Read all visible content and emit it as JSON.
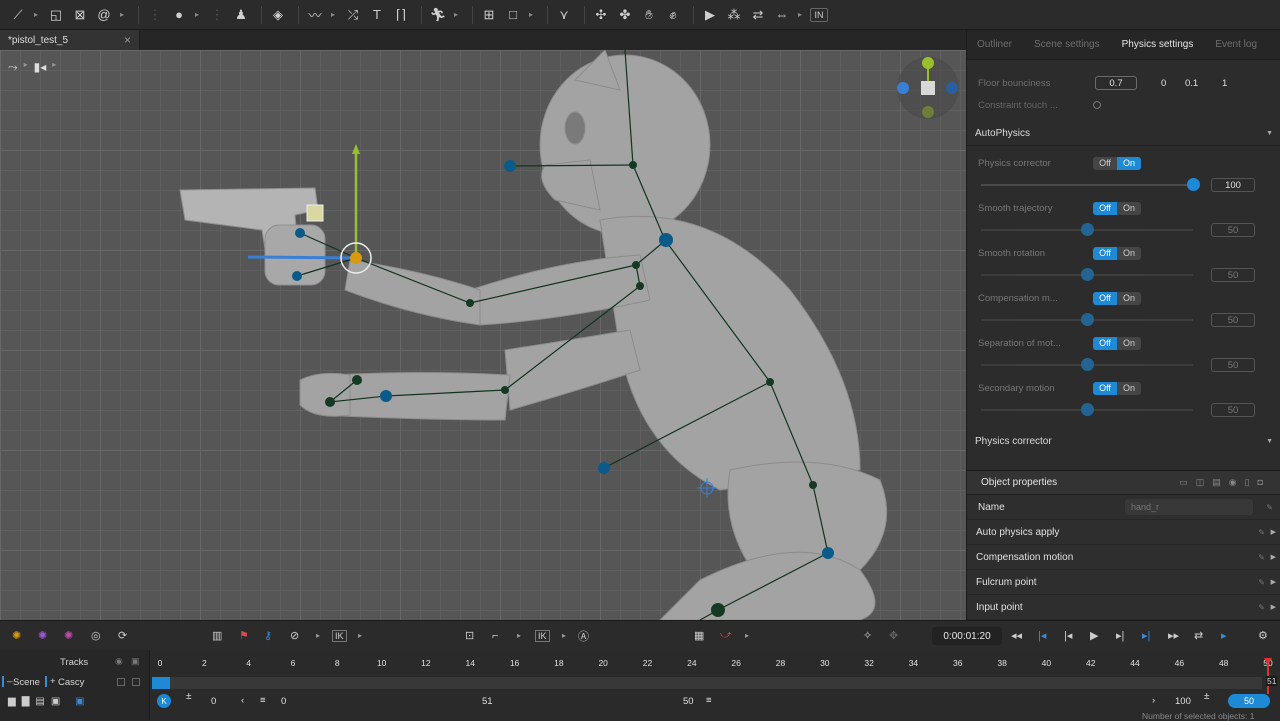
{
  "document_tab": {
    "title": "*pistol_test_5",
    "close": "×"
  },
  "toolbar": {
    "last_label": "IN"
  },
  "right_panel": {
    "tabs": [
      "Outliner",
      "Scene settings",
      "Physics settings",
      "Event log"
    ],
    "active_tab": "Physics settings",
    "floor_bounciness": {
      "label": "Floor bounciness",
      "value": "0.7",
      "nums": [
        "0",
        "0.1",
        "1"
      ]
    },
    "constraint_touch": {
      "label": "Constraint touch ..."
    },
    "autophysics": {
      "header": "AutoPhysics",
      "off": "Off",
      "on": "On",
      "items": [
        {
          "label": "Physics corrector",
          "state": "on",
          "level": 100,
          "value": "100"
        },
        {
          "label": "Smooth trajectory",
          "state": "off",
          "level": 50,
          "value": "50"
        },
        {
          "label": "Smooth rotation",
          "state": "off",
          "level": 50,
          "value": "50"
        },
        {
          "label": "Compensation m...",
          "state": "off",
          "level": 50,
          "value": "50"
        },
        {
          "label": "Separation of mot...",
          "state": "off",
          "level": 50,
          "value": "50"
        },
        {
          "label": "Secondary motion",
          "state": "off",
          "level": 50,
          "value": "50"
        }
      ]
    },
    "physics_corrector_header": "Physics corrector",
    "object_properties": {
      "header": "Object properties",
      "name_label": "Name",
      "name_value": "hand_r",
      "rows": [
        "Auto physics apply",
        "Compensation motion",
        "Fulcrum point",
        "Input point"
      ]
    }
  },
  "playbar": {
    "time": "0:00:01:20",
    "ik_label": "IK"
  },
  "timeline": {
    "tracks_label": "Tracks",
    "scene_label": "Scene",
    "cascy_label": "Cascy",
    "ticks": [
      "0",
      "2",
      "4",
      "6",
      "8",
      "10",
      "12",
      "14",
      "16",
      "18",
      "20",
      "22",
      "24",
      "26",
      "28",
      "30",
      "32",
      "34",
      "36",
      "38",
      "40",
      "42",
      "44",
      "46",
      "48",
      "50"
    ],
    "end_marker": "51",
    "start_value": "0",
    "mid_value": "0",
    "range_value": "51",
    "range_end": "50",
    "zoom": "100",
    "fps": "50",
    "status": "Number of selected objects: 1"
  },
  "colors": {
    "accent": "#1e8ad6",
    "bone": "#0a5a8a",
    "gizmo_y": "#9bbf2a",
    "gizmo_x": "#3a7fd6",
    "joint": "#d89a10"
  }
}
